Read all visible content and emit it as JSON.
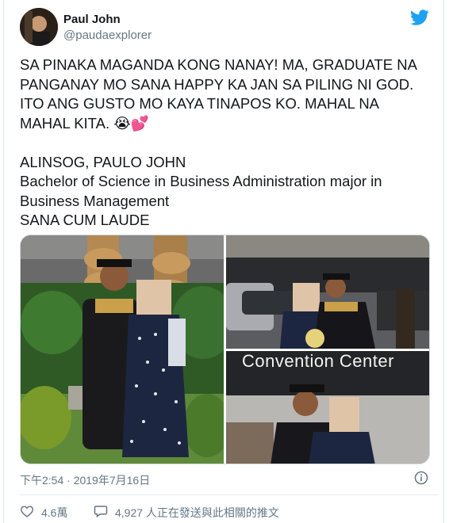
{
  "author": {
    "display_name": "Paul John",
    "handle": "@paudaexplorer"
  },
  "tweet": {
    "text": "SA PINAKA MAGANDA KONG NANAY! MA, GRADUATE NA PANGANAY MO SANA HAPPY KA JAN SA PILING NI GOD. ITO ANG GUSTO MO KAYA TINAPOS KO. MAHAL NA MAHAL KITA. 😭💕\n\nALINSOG, PAULO JOHN\nBachelor of Science in Business Administration major in Business Management\nSANA CUM LAUDE"
  },
  "media": {
    "photo3_sign": "Convention Center"
  },
  "footer": {
    "timestamp": "下午2:54 · 2019年7月16日",
    "like_count": "4.6萬",
    "reply_text": "4,927 人正在發送與此相關的推文"
  },
  "colors": {
    "twitter_blue": "#1da1f2",
    "meta_gray": "#657786",
    "text": "#14171a"
  },
  "icons": [
    "twitter-bird-icon",
    "info-icon",
    "heart-icon",
    "reply-bubble-icon"
  ]
}
